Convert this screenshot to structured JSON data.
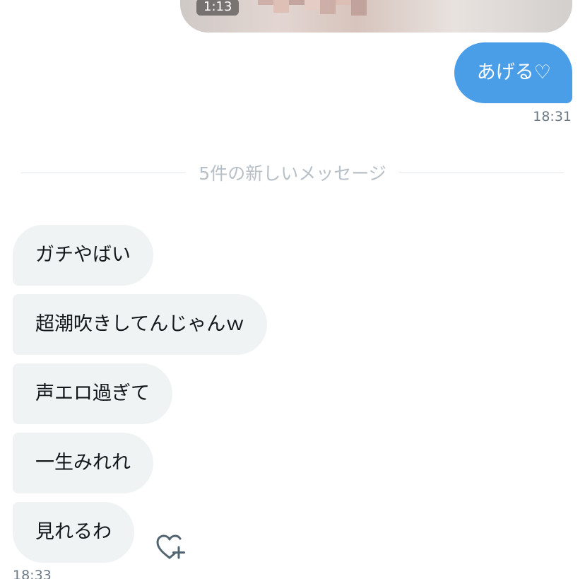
{
  "video": {
    "duration": "1:13"
  },
  "sent": {
    "message": "あげる♡",
    "time": "18:31"
  },
  "divider": {
    "label": "5件の新しいメッセージ"
  },
  "received": {
    "messages": [
      "ガチやばい",
      "超潮吹きしてんじゃんｗ",
      "声エロ過ぎて",
      "一生みれれ",
      "見れるわ"
    ],
    "time": "18:33"
  },
  "icons": {
    "react": "heart-plus-icon"
  },
  "colors": {
    "sent_bubble": "#4a9ee8",
    "received_bubble": "#eff3f4",
    "timestamp": "#6b7883",
    "divider_text": "#b8c0c7"
  }
}
